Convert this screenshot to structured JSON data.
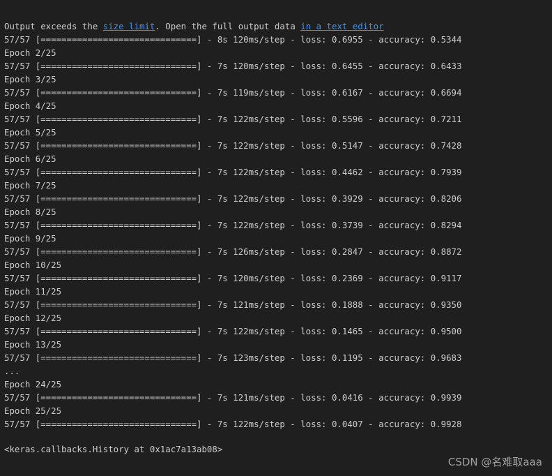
{
  "notice": {
    "prefix": "Output exceeds the ",
    "link1": "size limit",
    "middle": ". Open the full output data ",
    "link2": "in a text editor"
  },
  "lines": [
    "57/57 [==============================] - 8s 120ms/step - loss: 0.6955 - accuracy: 0.5344",
    "Epoch 2/25",
    "57/57 [==============================] - 7s 120ms/step - loss: 0.6455 - accuracy: 0.6433",
    "Epoch 3/25",
    "57/57 [==============================] - 7s 119ms/step - loss: 0.6167 - accuracy: 0.6694",
    "Epoch 4/25",
    "57/57 [==============================] - 7s 122ms/step - loss: 0.5596 - accuracy: 0.7211",
    "Epoch 5/25",
    "57/57 [==============================] - 7s 122ms/step - loss: 0.5147 - accuracy: 0.7428",
    "Epoch 6/25",
    "57/57 [==============================] - 7s 122ms/step - loss: 0.4462 - accuracy: 0.7939",
    "Epoch 7/25",
    "57/57 [==============================] - 7s 122ms/step - loss: 0.3929 - accuracy: 0.8206",
    "Epoch 8/25",
    "57/57 [==============================] - 7s 122ms/step - loss: 0.3739 - accuracy: 0.8294",
    "Epoch 9/25",
    "57/57 [==============================] - 7s 126ms/step - loss: 0.2847 - accuracy: 0.8872",
    "Epoch 10/25",
    "57/57 [==============================] - 7s 120ms/step - loss: 0.2369 - accuracy: 0.9117",
    "Epoch 11/25",
    "57/57 [==============================] - 7s 121ms/step - loss: 0.1888 - accuracy: 0.9350",
    "Epoch 12/25",
    "57/57 [==============================] - 7s 122ms/step - loss: 0.1465 - accuracy: 0.9500",
    "Epoch 13/25",
    "57/57 [==============================] - 7s 123ms/step - loss: 0.1195 - accuracy: 0.9683",
    "...",
    "Epoch 24/25",
    "57/57 [==============================] - 7s 121ms/step - loss: 0.0416 - accuracy: 0.9939",
    "Epoch 25/25",
    "57/57 [==============================] - 7s 122ms/step - loss: 0.0407 - accuracy: 0.9928"
  ],
  "result": "<keras.callbacks.History at 0x1ac7a13ab08>",
  "watermark": "CSDN @名难取aaa",
  "colors": {
    "background": "#1f1f1f",
    "text": "#cccccc",
    "link": "#3794ff"
  }
}
